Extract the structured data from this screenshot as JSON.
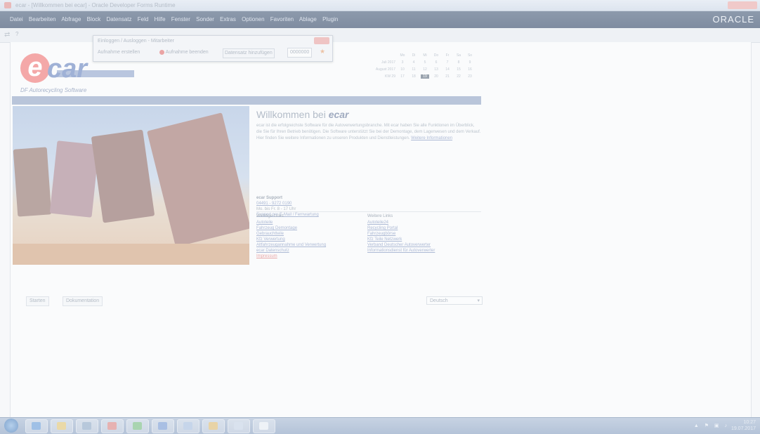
{
  "window": {
    "title": "ecar - [Willkommen bei ecar] - Oracle Developer Forms Runtime"
  },
  "menubar": {
    "items": [
      "Datei",
      "Bearbeiten",
      "Abfrage",
      "Block",
      "Datensatz",
      "Feld",
      "Hilfe",
      "Fenster",
      "Sonder",
      "Extras",
      "Optionen",
      "Favoriten",
      "Ablage",
      "Plugin"
    ],
    "brand": "ORACLE"
  },
  "toolbar": {
    "icon": "nav-arrow-icon",
    "help": "?"
  },
  "float_toolbar": {
    "title": "Einloggen / Ausloggen - Mitarbeiter",
    "buttons": [
      "Aufnahme erstellen",
      "Aufnahme beenden",
      "Datensatz hinzufügen"
    ],
    "field_value": "0000000"
  },
  "logo": {
    "e": "e",
    "car": "car",
    "subtitle": "DF Autorecycling Software"
  },
  "calendar": {
    "weekdays": [
      "Mo",
      "Di",
      "Mi",
      "Do",
      "Fr",
      "Sa",
      "So"
    ],
    "rows": [
      {
        "label": "Juli 2017",
        "days": [
          "3",
          "4",
          "5",
          "6",
          "7",
          "8",
          "9"
        ]
      },
      {
        "label": "August 2017",
        "days": [
          "10",
          "11",
          "12",
          "13",
          "14",
          "15",
          "16"
        ]
      },
      {
        "label": "KW 29",
        "days": [
          "17",
          "18",
          "19",
          "20",
          "21",
          "22",
          "23"
        ]
      }
    ],
    "today": "19"
  },
  "welcome": {
    "heading_prefix": "Willkommen bei",
    "heading_brand": "ecar",
    "paragraph": "ecar ist die erfolgreichste Software für die Autoverwertungsbranche. Mit ecar haben Sie alle Funktionen im Überblick, die Sie für Ihren Betrieb benötigen. Die Software unterstützt Sie bei der Demontage, dem Lagerwesen und dem Verkauf. Hier finden Sie weitere Informationen zu unseren Produkten und Dienstleistungen.",
    "more_link": "Weitere Informationen"
  },
  "support": {
    "title": "ecar Support",
    "phone": "04491 - 9272 0190",
    "hours": "Mo. bis Fr. 8 - 17 Uhr",
    "link": "Support per E-Mail / Fernwartung"
  },
  "links_left": {
    "title": "Wichtige Links",
    "items": [
      "Autoteile",
      "Fahrzeug Demontage",
      "Gebrauchtteile",
      "Kfz Verwertung",
      "Altfahrzeugannahme und Verwertung",
      "ecar Datenschutz",
      "Impressum"
    ]
  },
  "links_right": {
    "title": "Weitere Links",
    "items": [
      "Autoteile24",
      "Recycling Portal",
      "Fahrzeugbörse",
      "Kfz Teile Netzwerk",
      "Verband Deutscher Autoverwerter",
      "Informationsdienst für Autoverwerter"
    ]
  },
  "buttons": {
    "start": "Starten",
    "info": "Dokumentation"
  },
  "language": {
    "value": "Deutsch"
  },
  "taskbar": {
    "time": "10:27",
    "date": "19.07.2017"
  }
}
